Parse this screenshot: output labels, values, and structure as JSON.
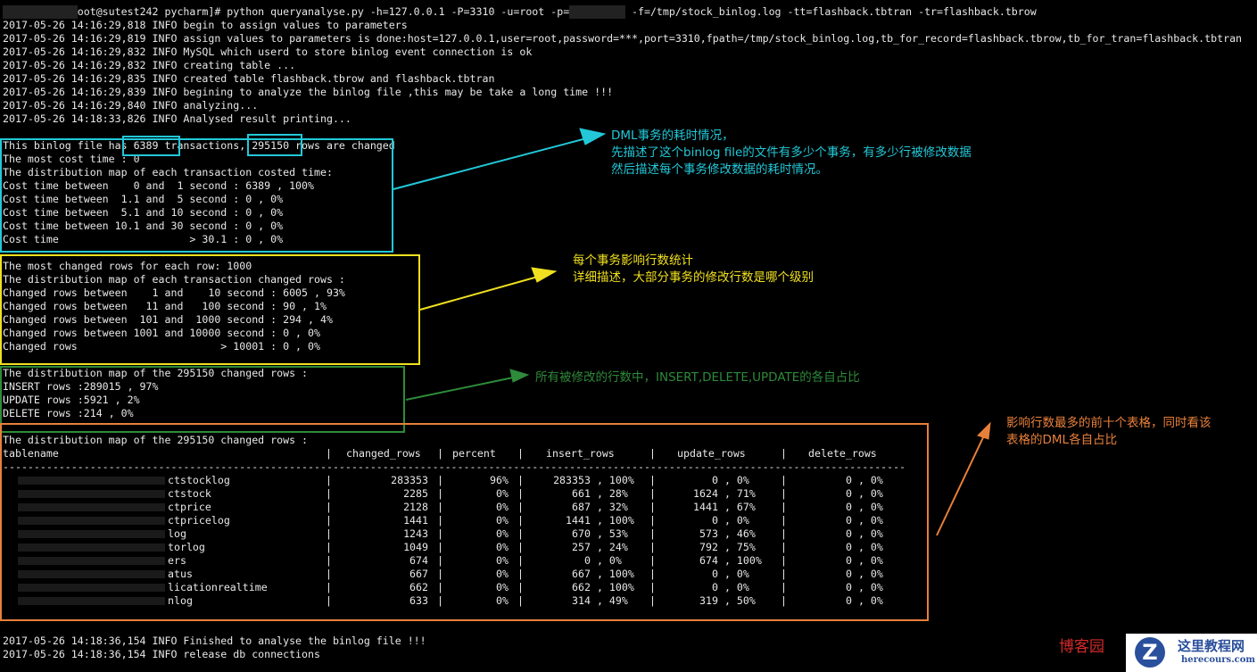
{
  "command": {
    "prompt_suffix": "oot@sutest242 pycharm]# python queryanalyse.py -h=127.0.0.1 -P=3310 -u=root -p=",
    "args_after": " -f=/tmp/stock_binlog.log -tt=flashback.tbtran -tr=flashback.tbrow"
  },
  "log_start": [
    "2017-05-26 14:16:29,818 INFO begin to assign values to parameters",
    "2017-05-26 14:16:29,819 INFO assign values to parameters is done:host=127.0.0.1,user=root,password=***,port=3310,fpath=/tmp/stock_binlog.log,tb_for_record=flashback.tbrow,tb_for_tran=flashback.tbtran",
    "2017-05-26 14:16:29,832 INFO MySQL which userd to store binlog event connection is ok",
    "2017-05-26 14:16:29,832 INFO creating table ...",
    "2017-05-26 14:16:29,835 INFO created table flashback.tbrow and flashback.tbtran",
    "2017-05-26 14:16:29,839 INFO begining to analyze the binlog file ,this may be take a long time !!!",
    "2017-05-26 14:16:29,840 INFO analyzing...",
    "2017-05-26 14:18:33,826 INFO Analysed result printing...",
    ""
  ],
  "cost_section": [
    "This binlog file has 6389 transactions, 295150 rows are changed",
    "The most cost time : 0",
    "The distribution map of each transaction costed time:",
    "Cost time between    0 and  1 second : 6389 , 100%",
    "Cost time between  1.1 and  5 second : 0 , 0%",
    "Cost time between  5.1 and 10 second : 0 , 0%",
    "Cost time between 10.1 and 30 second : 0 , 0%",
    "Cost time                     > 30.1 : 0 , 0%",
    ""
  ],
  "rows_section": [
    "The most changed rows for each row: 1000",
    "The distribution map of each transaction changed rows :",
    "Changed rows between    1 and    10 second : 6005 , 93%",
    "Changed rows between   11 and   100 second : 90 , 1%",
    "Changed rows between  101 and  1000 second : 294 , 4%",
    "Changed rows between 1001 and 10000 second : 0 , 0%",
    "Changed rows                       > 10001 : 0 , 0%",
    ""
  ],
  "dml_section": [
    "The distribution map of the 295150 changed rows :",
    "INSERT rows :289015 , 97%",
    "UPDATE rows :5921 , 2%",
    "DELETE rows :214 , 0%",
    ""
  ],
  "table_section": {
    "title": "The distribution map of the 295150 changed rows :",
    "headers": [
      "tablename",
      "changed_rows",
      "percent",
      "insert_rows",
      "update_rows",
      "delete_rows"
    ],
    "rows": [
      [
        "ctstocklog",
        "283353",
        "96%",
        "283353 , 100%",
        "0 , 0%",
        "0 , 0%"
      ],
      [
        "ctstock",
        "2285",
        "0%",
        "661 , 28%",
        "1624 , 71%",
        "0 , 0%"
      ],
      [
        "ctprice",
        "2128",
        "0%",
        "687 , 32%",
        "1441 , 67%",
        "0 , 0%"
      ],
      [
        "ctpricelog",
        "1441",
        "0%",
        "1441 , 100%",
        "0 , 0%",
        "0 , 0%"
      ],
      [
        "log",
        "1243",
        "0%",
        "670 , 53%",
        "573 , 46%",
        "0 , 0%"
      ],
      [
        "torlog",
        "1049",
        "0%",
        "257 , 24%",
        "792 , 75%",
        "0 , 0%"
      ],
      [
        "ers",
        "674",
        "0%",
        "0 , 0%",
        "674 , 100%",
        "0 , 0%"
      ],
      [
        "atus",
        "667",
        "0%",
        "667 , 100%",
        "0 , 0%",
        "0 , 0%"
      ],
      [
        "licationrealtime",
        "662",
        "0%",
        "662 , 100%",
        "0 , 0%",
        "0 , 0%"
      ],
      [
        "nlog",
        "633",
        "0%",
        "314 , 49%",
        "319 , 50%",
        "0 , 0%"
      ]
    ]
  },
  "log_end": [
    "2017-05-26 14:18:36,154 INFO Finished to analyse the binlog file !!!",
    "2017-05-26 14:18:36,154 INFO release db connections"
  ],
  "annotations": {
    "cost": "DML事务的耗时情况，\n先描述了这个binlog file的文件有多少个事务，有多少行被修改数据\n然后描述每个事务修改数据的耗时情况。",
    "rows": "每个事务影响行数统计\n详细描述，大部分事务的修改行数是哪个级别",
    "dml": "所有被修改的行数中，INSERT,DELETE,UPDATE的各自占比",
    "tables": "影响行数最多的前十个表格，同时看该\n表格的DML各自占比"
  },
  "colors": {
    "cyan": "#22c8d8",
    "yellow": "#f0e020",
    "green": "#2e8b3a",
    "orange": "#e8803a"
  },
  "watermark": {
    "blog": "博客园",
    "logo_cn": "这里教程网",
    "logo_en": "herecours.com"
  }
}
